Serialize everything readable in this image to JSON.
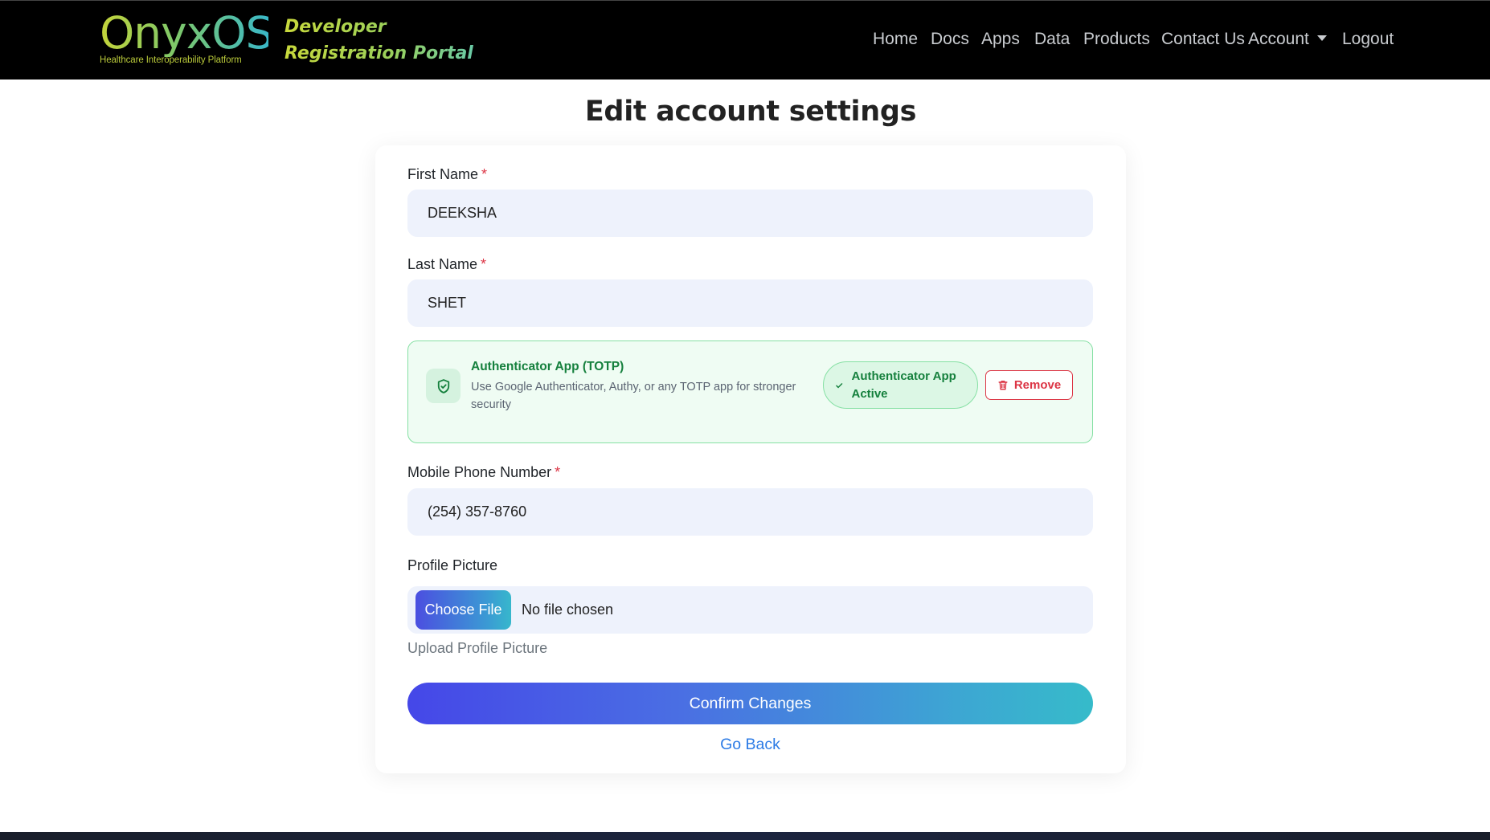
{
  "brand": {
    "logo_text": "OnyxOS",
    "logo_subtitle": "Healthcare Interoperability Platform",
    "portal_title": "Developer Registration Portal",
    "gradient_start": "#c5d43a",
    "gradient_end": "#3ab8c8"
  },
  "nav": {
    "items": [
      "Home",
      "Docs",
      "Apps",
      "Data",
      "Products",
      "Contact Us"
    ],
    "account": "Account",
    "logout": "Logout"
  },
  "page": {
    "title": "Edit account settings"
  },
  "form": {
    "first_name": {
      "label": "First Name",
      "required_mark": "*",
      "value": "DEEKSHA"
    },
    "last_name": {
      "label": "Last Name",
      "required_mark": "*",
      "value": "SHET"
    },
    "totp": {
      "title": "Authenticator App (TOTP)",
      "description": "Use Google Authenticator, Authy, or any TOTP app for stronger security",
      "status_label": "Authenticator App Active",
      "remove_label": "Remove",
      "icon": "shield-check-icon",
      "accent": "#15803d"
    },
    "phone": {
      "label": "Mobile Phone Number",
      "required_mark": "*",
      "value": "(254) 357-8760"
    },
    "profile_picture": {
      "label": "Profile Picture",
      "button_label": "Choose File",
      "file_status": "No file chosen",
      "help_text": "Upload Profile Picture"
    },
    "confirm_label": "Confirm Changes",
    "back_label": "Go Back"
  }
}
